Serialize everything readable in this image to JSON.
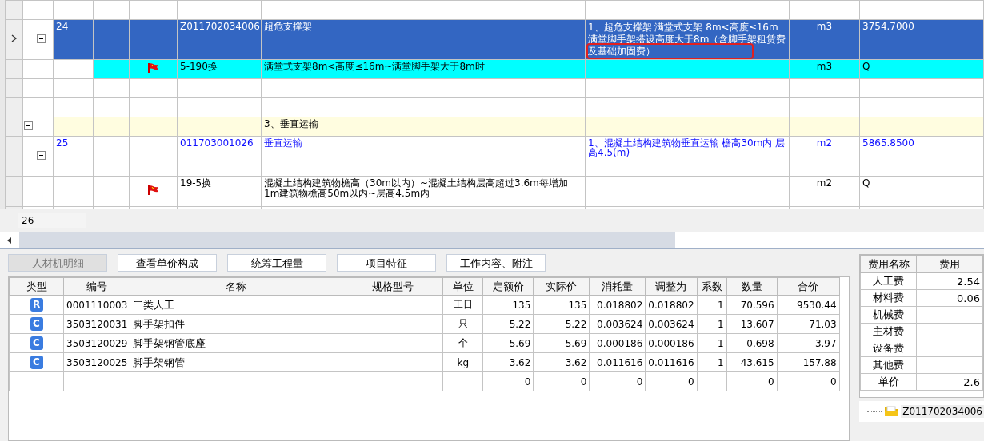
{
  "grid": {
    "rows": [
      {
        "kind": "blank",
        "selected": false,
        "highlighted": false
      },
      {
        "kind": "item",
        "selected": true,
        "highlighted": false,
        "expanded": true,
        "number": "24",
        "code": "Z011702034006",
        "name": "超危支撑架",
        "feature": "1、超危支撑架 满堂式支架 8m<高度≤16m 满堂脚手架搭设高度大于8m（含脚手架租赁费及基础加固费）",
        "unit": "m3",
        "quantity": "3754.7000",
        "annotated": true
      },
      {
        "kind": "sub",
        "selected": false,
        "highlighted": true,
        "code": "5-190换",
        "name": "满堂式支架8m<高度≤16m~满堂脚手架大于8m时",
        "unit": "m3",
        "quantity": "Q"
      },
      {
        "kind": "blank",
        "selected": false,
        "highlighted": false
      },
      {
        "kind": "blank",
        "selected": false,
        "highlighted": false
      },
      {
        "kind": "group",
        "selected": false,
        "highlighted": false,
        "expanded": true,
        "name": "3、垂直运输"
      },
      {
        "kind": "item",
        "selected": false,
        "highlighted": false,
        "expanded": true,
        "number": "25",
        "code": "011703001026",
        "name": "垂直运输",
        "feature": "1、混凝土结构建筑物垂直运输 檐高30m内 层高4.5(m)",
        "unit": "m2",
        "quantity": "5865.8500",
        "annotated": false
      },
      {
        "kind": "sub",
        "selected": false,
        "highlighted": false,
        "code": "19-5换",
        "name": "混凝土结构建筑物檐高（30m以内）~混凝土结构层高超过3.6m每增加1m建筑物檐高50m以内~层高4.5m内",
        "unit": "m2",
        "quantity": "Q"
      },
      {
        "kind": "blank",
        "selected": false,
        "highlighted": false
      }
    ]
  },
  "status_field": "26",
  "tabs": [
    {
      "label": "人材机明细",
      "selected": true
    },
    {
      "label": "查看单价构成",
      "selected": false
    },
    {
      "label": "统筹工程量",
      "selected": false
    },
    {
      "label": "项目特征",
      "selected": false
    },
    {
      "label": "工作内容、附注",
      "selected": false
    }
  ],
  "materials": {
    "columns": [
      "类型",
      "编号",
      "名称",
      "规格型号",
      "单位",
      "定额价",
      "实际价",
      "消耗量",
      "调整为",
      "系数",
      "数量",
      "合价"
    ],
    "rows": [
      [
        "R",
        "0001110003",
        "二类人工",
        "",
        "工日",
        "135",
        "135",
        "0.018802",
        "0.018802",
        "1",
        "70.596",
        "9530.44"
      ],
      [
        "C",
        "3503120031",
        "脚手架扣件",
        "",
        "只",
        "5.22",
        "5.22",
        "0.003624",
        "0.003624",
        "1",
        "13.607",
        "71.03"
      ],
      [
        "C",
        "3503120029",
        "脚手架钢管底座",
        "",
        "个",
        "5.69",
        "5.69",
        "0.000186",
        "0.000186",
        "1",
        "0.698",
        "3.97"
      ],
      [
        "C",
        "3503120025",
        "脚手架钢管",
        "",
        "kg",
        "3.62",
        "3.62",
        "0.011616",
        "0.011616",
        "1",
        "43.615",
        "157.88"
      ],
      [
        "",
        "",
        "",
        "",
        "",
        "0",
        "0",
        "0",
        "0",
        "",
        "0",
        "0"
      ]
    ]
  },
  "fees": {
    "columns": [
      "费用名称",
      "费用"
    ],
    "rows": [
      [
        "人工费",
        "2.54"
      ],
      [
        "材料费",
        "0.06"
      ],
      [
        "机械费",
        ""
      ],
      [
        "主材费",
        ""
      ],
      [
        "设备费",
        ""
      ],
      [
        "其他费",
        ""
      ],
      [
        "单价",
        "2.6"
      ]
    ]
  },
  "tree_item": "Z011702034006"
}
